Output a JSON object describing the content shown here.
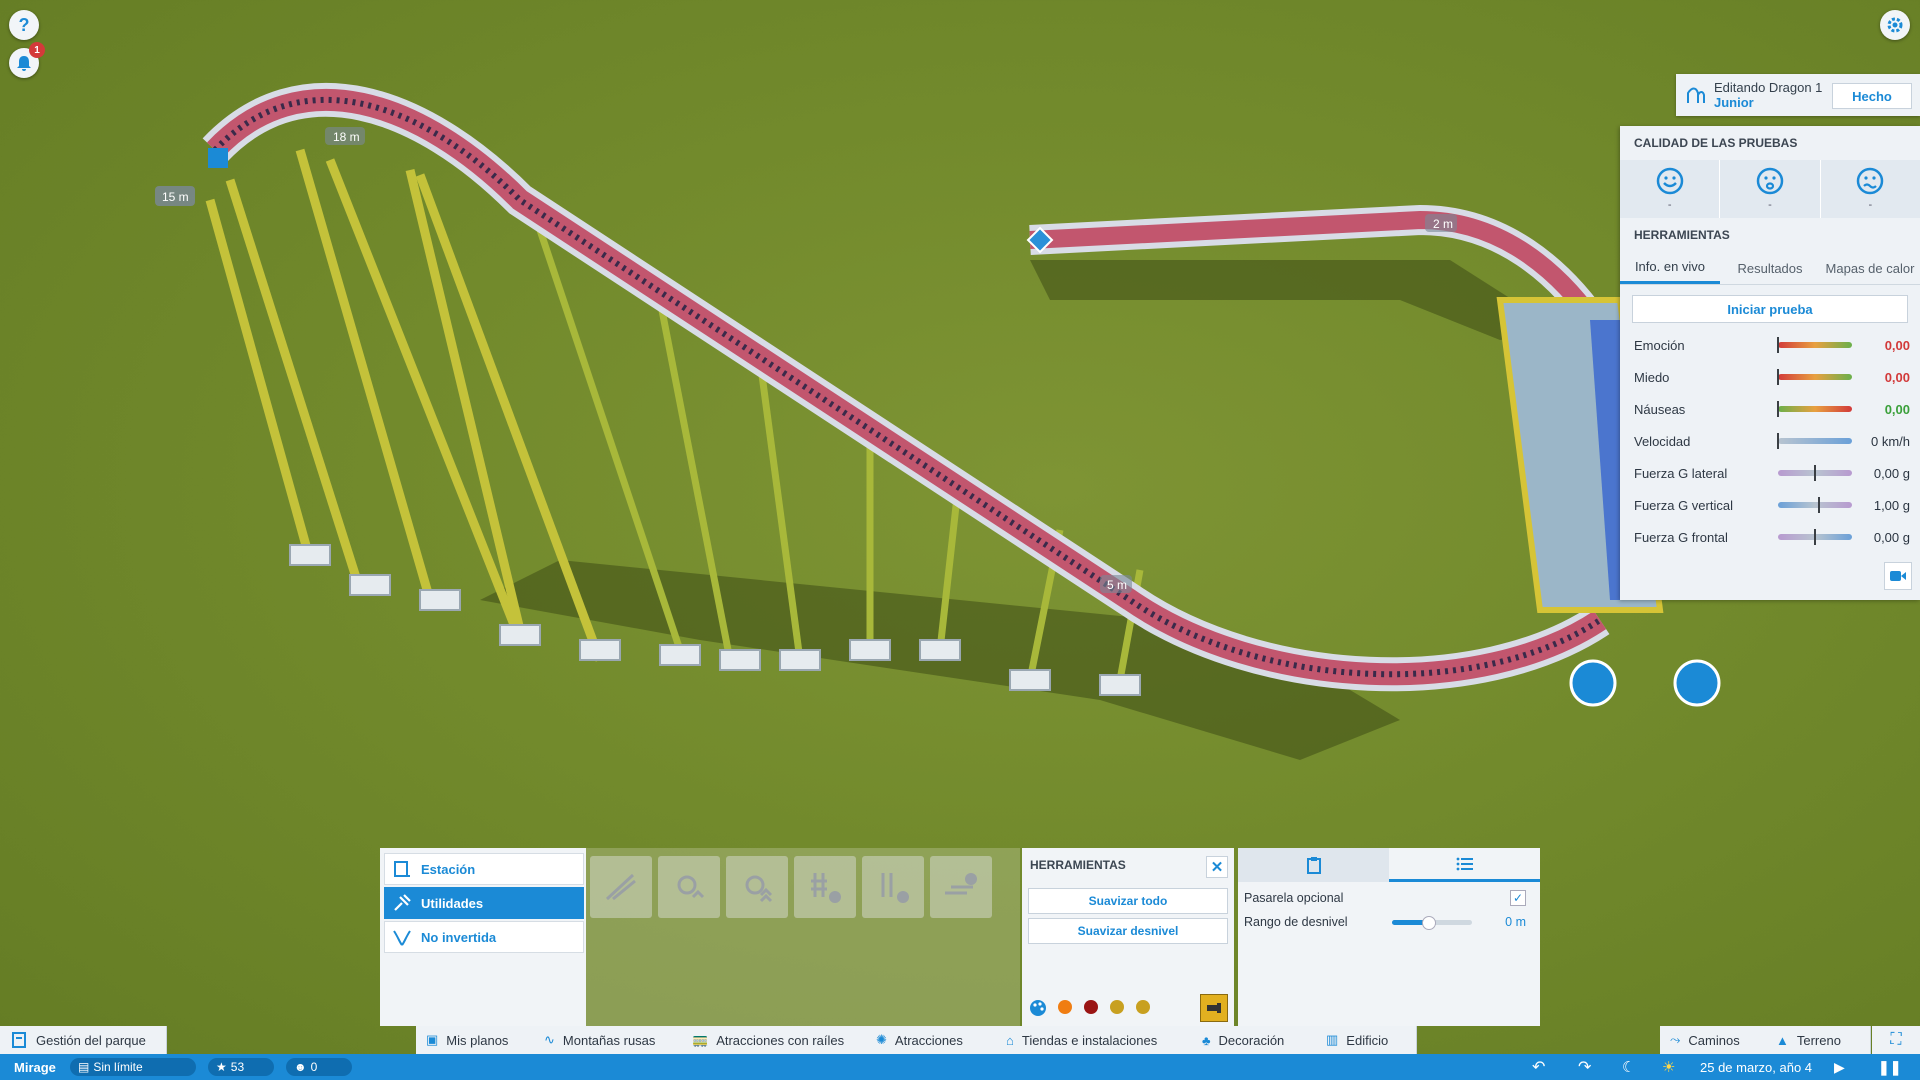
{
  "hud": {
    "notification_count": "1"
  },
  "scene_labels": {
    "height_a": "15 m",
    "height_b": "18 m",
    "height_c": "2 m",
    "height_d": "5 m"
  },
  "editing": {
    "title": "Editando Dragon 1",
    "subtitle": "Junior",
    "done_label": "Hecho"
  },
  "right_panel": {
    "quality_title": "CALIDAD DE LAS PRUEBAS",
    "faces": [
      "-",
      "-",
      "-"
    ],
    "tools_title": "HERRAMIENTAS",
    "tabs": [
      "Info. en vivo",
      "Resultados",
      "Mapas de calor"
    ],
    "start_label": "Iniciar prueba",
    "stats": [
      {
        "label": "Emoción",
        "value": "0,00",
        "color": "#d23a3a"
      },
      {
        "label": "Miedo",
        "value": "0,00",
        "color": "#d23a3a"
      },
      {
        "label": "Náuseas",
        "value": "0,00",
        "color": "#3aa03a"
      },
      {
        "label": "Velocidad",
        "value": "0 km/h",
        "color": "#2e3844"
      },
      {
        "label": "Fuerza G lateral",
        "value": "0,00 g",
        "color": "#2e3844"
      },
      {
        "label": "Fuerza G vertical",
        "value": "1,00 g",
        "color": "#2e3844"
      },
      {
        "label": "Fuerza G frontal",
        "value": "0,00 g",
        "color": "#2e3844"
      }
    ]
  },
  "builder": {
    "categories": [
      "Estación",
      "Utilidades",
      "No invertida"
    ],
    "tools_title": "HERRAMIENTAS",
    "smooth_all": "Suavizar todo",
    "smooth_slope": "Suavizar desnivel",
    "swatch_colors": [
      "#f07d12",
      "#9a1414",
      "#c8a020",
      "#c8a020"
    ],
    "options": {
      "walkway_label": "Pasarela opcional",
      "walkway_checked": true,
      "range_label": "Rango de desnivel",
      "range_value": "0 m",
      "range_fraction": 0.45
    }
  },
  "bottom_bar": {
    "park_management": "Gestión del parque",
    "tabs": [
      "Mis planos",
      "Montañas rusas",
      "Atracciones con raíles",
      "Atracciones",
      "Tiendas e instalaciones",
      "Decoración",
      "Edificio"
    ],
    "right_tabs": [
      "Caminos",
      "Terreno"
    ]
  },
  "status": {
    "park_name": "Mirage",
    "money": "Sin límite",
    "rating": "53",
    "guests": "0",
    "date": "25 de marzo, año 4"
  }
}
